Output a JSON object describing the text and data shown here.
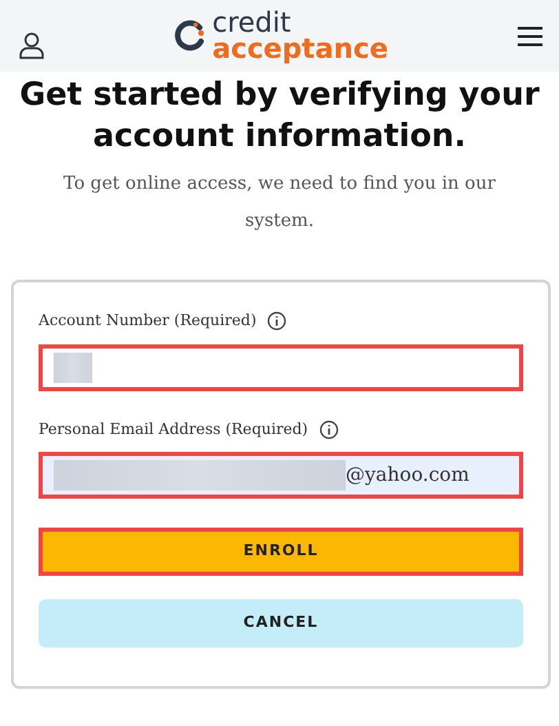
{
  "header": {
    "logo_top": "credit",
    "logo_bottom": "acceptance"
  },
  "title": "Get started by verifying your account information.",
  "subtitle": "To get online access, we need to find you in our system.",
  "fields": [
    {
      "label": "Account Number (Required)",
      "redacted": true,
      "highlighted": true,
      "filled": false
    },
    {
      "label": "Personal Email Address (Required)",
      "value": "@yahoo.com",
      "redacted": true,
      "highlighted": true,
      "filled": true
    }
  ],
  "buttons": [
    {
      "label": "ENROLL",
      "kind": "primary",
      "highlighted": true
    },
    {
      "label": "CANCEL",
      "kind": "secondary",
      "highlighted": false
    }
  ]
}
